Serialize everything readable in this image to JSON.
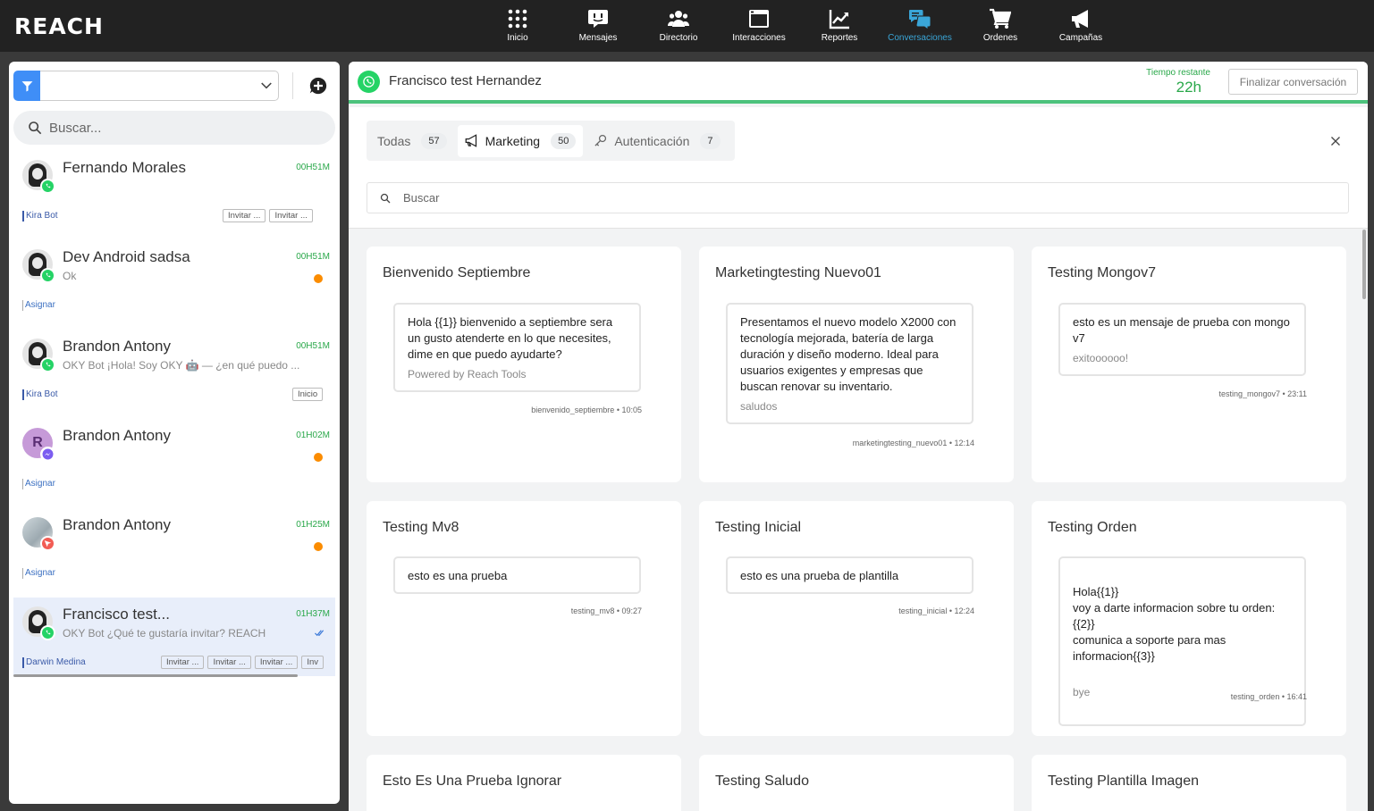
{
  "app": {
    "logo": "REACH"
  },
  "nav": [
    {
      "label": "Inicio",
      "icon": "grid-icon"
    },
    {
      "label": "Mensajes",
      "icon": "chat-bubble-icon"
    },
    {
      "label": "Directorio",
      "icon": "users-icon"
    },
    {
      "label": "Interacciones",
      "icon": "window-icon"
    },
    {
      "label": "Reportes",
      "icon": "chart-icon"
    },
    {
      "label": "Conversaciones",
      "icon": "conversations-icon",
      "active": true
    },
    {
      "label": "Ordenes",
      "icon": "cart-icon"
    },
    {
      "label": "Campañas",
      "icon": "megaphone-icon"
    }
  ],
  "left": {
    "search_placeholder": "Buscar...",
    "conversations": [
      {
        "name": "Fernando Morales",
        "time": "00H51M",
        "preview": "",
        "channel": "whatsapp",
        "agent": "Kira Bot",
        "tags": [
          "Invitar ...",
          "Invitar ..."
        ],
        "unread": false
      },
      {
        "name": "Dev Android sadsa",
        "time": "00H51M",
        "preview": "Ok",
        "channel": "whatsapp",
        "agent": "Asignar",
        "tags": [],
        "unread": true
      },
      {
        "name": "Brandon Antony",
        "time": "00H51M",
        "preview": "OKY Bot ¡Hola! Soy OKY 🤖 — ¿en qué puedo ...",
        "channel": "whatsapp",
        "agent": "Kira Bot",
        "tags": [
          "Inicio"
        ],
        "unread": false
      },
      {
        "name": "Brandon Antony",
        "time": "01H02M",
        "preview": "",
        "channel": "messenger",
        "avatar_letter": "R",
        "agent": "Asignar",
        "tags": [],
        "unread": true
      },
      {
        "name": "Brandon Antony",
        "time": "01H25M",
        "preview": "",
        "channel": "web",
        "agent": "Asignar",
        "tags": [],
        "unread": true
      },
      {
        "name": "Francisco test...",
        "time": "01H37M",
        "preview": "OKY Bot ¿Qué te gustaría invitar? REACH",
        "channel": "whatsapp",
        "agent": "Darwin Medina",
        "tags": [
          "Invitar ...",
          "Invitar ...",
          "Invitar ...",
          "Inv"
        ],
        "unread": false,
        "selected": true
      }
    ]
  },
  "chat": {
    "contact": "Francisco test Hernandez",
    "time_label": "Tiempo restante",
    "time_value": "22h",
    "finish_button": "Finalizar conversación"
  },
  "templates": {
    "tabs": [
      {
        "label": "Todas",
        "count": "57"
      },
      {
        "label": "Marketing",
        "count": "50",
        "active": true
      },
      {
        "label": "Autenticación",
        "count": "7"
      }
    ],
    "search_placeholder": "Buscar",
    "cards": [
      {
        "title": "Bienvenido Septiembre",
        "body": "Hola {{1}} bienvenido a septiembre sera un gusto atenderte en lo que necesites, dime en que puedo ayudarte?",
        "footer": "Powered by Reach Tools",
        "meta": "bienvenido_septiembre • 10:05"
      },
      {
        "title": "Marketingtesting Nuevo01",
        "body": "Presentamos el nuevo modelo X2000 con tecnología mejorada, batería de larga duración y diseño moderno. Ideal para usuarios exigentes y empresas que buscan renovar su inventario.",
        "footer": "saludos",
        "meta": "marketingtesting_nuevo01 • 12:14"
      },
      {
        "title": "Testing Mongov7",
        "body": "esto es un mensaje de prueba con mongo v7",
        "footer": "exitoooooo!",
        "meta": "testing_mongov7 • 23:11"
      },
      {
        "title": "Testing Mv8",
        "body": "esto es una prueba",
        "footer": "",
        "meta": "testing_mv8 • 09:27"
      },
      {
        "title": "Testing Inicial",
        "body": "esto es una prueba de plantilla",
        "footer": "",
        "meta": "testing_inicial • 12:24"
      },
      {
        "title": "Testing Orden",
        "body": "Hola{{1}}\nvoy a darte informacion sobre tu orden: {{2}}\ncomunica a soporte para mas informacion{{3}}",
        "footer": "bye",
        "meta": "testing_orden • 16:41"
      },
      {
        "title": "Esto Es Una Prueba Ignorar",
        "body": "",
        "footer": "",
        "meta": ""
      },
      {
        "title": "Testing Saludo",
        "body": "",
        "footer": "",
        "meta": ""
      },
      {
        "title": "Testing Plantilla Imagen",
        "body": "",
        "footer": "",
        "meta": ""
      }
    ]
  },
  "colors": {
    "accent": "#3aa6d8",
    "green": "#2aa84a",
    "whatsapp": "#25d366",
    "unread": "#fb8c00"
  }
}
